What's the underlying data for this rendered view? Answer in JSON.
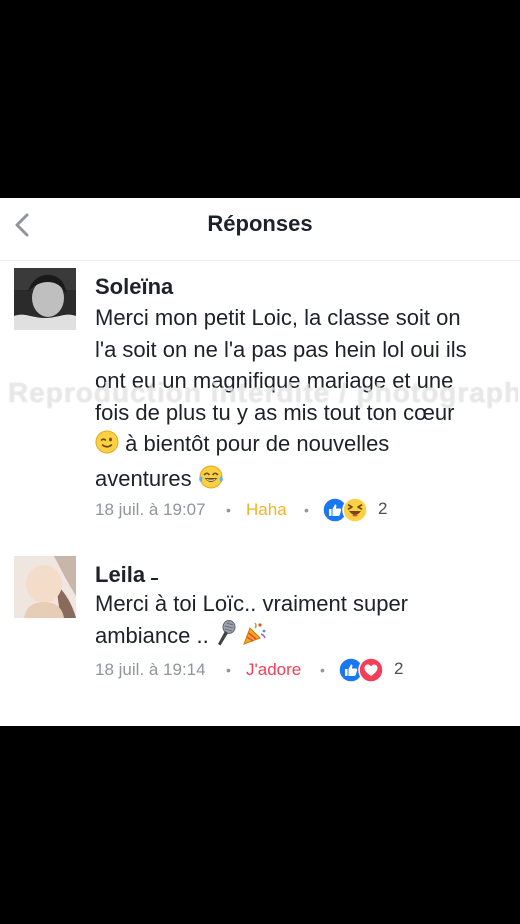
{
  "header": {
    "title": "Réponses",
    "back_icon": "chevron-left-icon"
  },
  "comments": [
    {
      "author": "Soleïna",
      "lines": [
        "Merci mon petit Loic, la classe soit on",
        "l'a soit on ne l'a pas pas hein lol oui ils",
        "ont eu un magnifique mariage et une",
        "fois de plus tu y as mis tout ton cœur",
        " à bientôt pour de nouvelles",
        "aventures "
      ],
      "timestamp": "18 juil. à 19:07",
      "reaction_label": "Haha",
      "reaction_label_color": "#f7b125",
      "reaction_icons": [
        "like-icon",
        "haha-icon"
      ],
      "reaction_count": "2"
    },
    {
      "author": "Leila",
      "lines": [
        "Merci à toi Loïc.. vraiment super",
        "ambiance .. "
      ],
      "timestamp": "18 juil. à 19:14",
      "reaction_label": "J'adore",
      "reaction_label_color": "#f33e58",
      "reaction_icons": [
        "like-icon",
        "love-icon"
      ],
      "reaction_count": "2"
    }
  ],
  "watermark": "Reproduction interdite / photographe mariage",
  "colors": {
    "like_blue": "#1877f2",
    "love_red": "#f33e58",
    "haha_yellow": "#f7b125",
    "meta_grey": "#90949c"
  }
}
